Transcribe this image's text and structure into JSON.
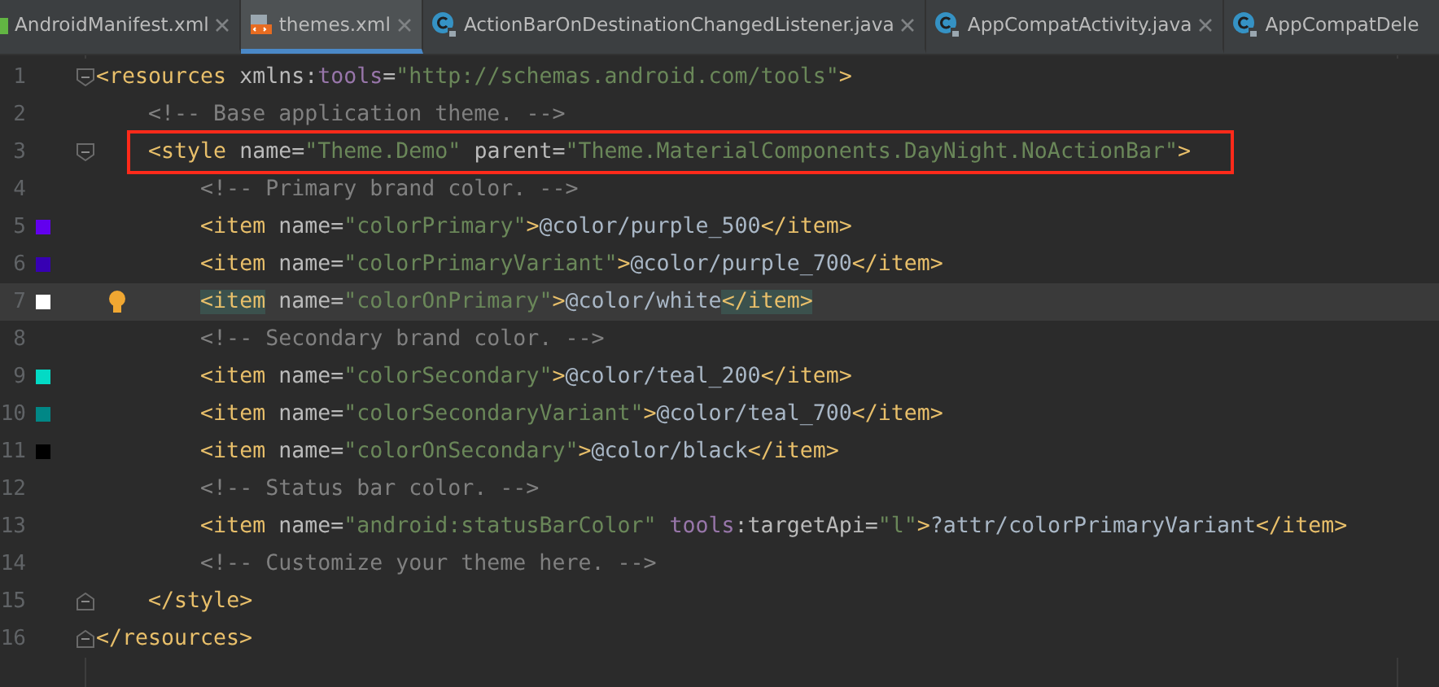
{
  "tabs": [
    {
      "label": "AndroidManifest.xml",
      "kind": "manifest",
      "selected": false,
      "closable": true
    },
    {
      "label": "themes.xml",
      "kind": "xml",
      "selected": true,
      "closable": true
    },
    {
      "label": "ActionBarOnDestinationChangedListener.java",
      "kind": "class",
      "selected": false,
      "closable": true
    },
    {
      "label": "AppCompatActivity.java",
      "kind": "class",
      "selected": false,
      "closable": true
    },
    {
      "label": "AppCompatDele",
      "kind": "class",
      "selected": false,
      "closable": false
    }
  ],
  "editor": {
    "lines": [
      {
        "number": "1",
        "fold_open": true,
        "tokens": [
          {
            "kind": "tag",
            "text": "<resources "
          },
          {
            "kind": "attr",
            "text": "xmlns:"
          },
          {
            "kind": "ns",
            "text": "tools"
          },
          {
            "kind": "attr",
            "text": "="
          },
          {
            "kind": "value",
            "text": "\"http://schemas.android.com/tools\""
          },
          {
            "kind": "tag",
            "text": ">"
          }
        ]
      },
      {
        "number": "2",
        "tokens": [
          {
            "kind": "comment",
            "text": "    <!-- Base application theme. -->"
          }
        ]
      },
      {
        "number": "3",
        "fold_open": true,
        "annotated": true,
        "tokens": [
          {
            "kind": "tag",
            "text": "    <style "
          },
          {
            "kind": "attr",
            "text": "name="
          },
          {
            "kind": "value",
            "text": "\"Theme.Demo\" "
          },
          {
            "kind": "attr",
            "text": "parent="
          },
          {
            "kind": "value",
            "text": "\"Theme.MaterialComponents.DayNight.NoActionBar\""
          },
          {
            "kind": "tag",
            "text": ">"
          }
        ]
      },
      {
        "number": "4",
        "tokens": [
          {
            "kind": "comment",
            "text": "        <!-- Primary brand color. -->"
          }
        ]
      },
      {
        "number": "5",
        "color": "#6200ee",
        "tokens": [
          {
            "kind": "tag",
            "text": "        <item "
          },
          {
            "kind": "attr",
            "text": "name="
          },
          {
            "kind": "value",
            "text": "\"colorPrimary\""
          },
          {
            "kind": "tag",
            "text": ">"
          },
          {
            "kind": "text",
            "text": "@color/purple_500"
          },
          {
            "kind": "tag",
            "text": "</item>"
          }
        ]
      },
      {
        "number": "6",
        "color": "#3700b3",
        "tokens": [
          {
            "kind": "tag",
            "text": "        <item "
          },
          {
            "kind": "attr",
            "text": "name="
          },
          {
            "kind": "value",
            "text": "\"colorPrimaryVariant\""
          },
          {
            "kind": "tag",
            "text": ">"
          },
          {
            "kind": "text",
            "text": "@color/purple_700"
          },
          {
            "kind": "tag",
            "text": "</item>"
          }
        ]
      },
      {
        "number": "7",
        "color": "#ffffff",
        "current": true,
        "bulb": true,
        "tokens": [
          {
            "kind": "tag",
            "text": "        <item",
            "matched": true
          },
          {
            "kind": "attr",
            "text": " name="
          },
          {
            "kind": "value",
            "text": "\"colorOnPrimary\""
          },
          {
            "kind": "tag",
            "text": ">"
          },
          {
            "kind": "text",
            "text": "@color/white"
          },
          {
            "kind": "tag",
            "text": "</item>",
            "matched": true
          }
        ]
      },
      {
        "number": "8",
        "tokens": [
          {
            "kind": "comment",
            "text": "        <!-- Secondary brand color. -->"
          }
        ]
      },
      {
        "number": "9",
        "color": "#03dac5",
        "tokens": [
          {
            "kind": "tag",
            "text": "        <item "
          },
          {
            "kind": "attr",
            "text": "name="
          },
          {
            "kind": "value",
            "text": "\"colorSecondary\""
          },
          {
            "kind": "tag",
            "text": ">"
          },
          {
            "kind": "text",
            "text": "@color/teal_200"
          },
          {
            "kind": "tag",
            "text": "</item>"
          }
        ]
      },
      {
        "number": "10",
        "color": "#018786",
        "tokens": [
          {
            "kind": "tag",
            "text": "        <item "
          },
          {
            "kind": "attr",
            "text": "name="
          },
          {
            "kind": "value",
            "text": "\"colorSecondaryVariant\""
          },
          {
            "kind": "tag",
            "text": ">"
          },
          {
            "kind": "text",
            "text": "@color/teal_700"
          },
          {
            "kind": "tag",
            "text": "</item>"
          }
        ]
      },
      {
        "number": "11",
        "color": "#000000",
        "tokens": [
          {
            "kind": "tag",
            "text": "        <item "
          },
          {
            "kind": "attr",
            "text": "name="
          },
          {
            "kind": "value",
            "text": "\"colorOnSecondary\""
          },
          {
            "kind": "tag",
            "text": ">"
          },
          {
            "kind": "text",
            "text": "@color/black"
          },
          {
            "kind": "tag",
            "text": "</item>"
          }
        ]
      },
      {
        "number": "12",
        "tokens": [
          {
            "kind": "comment",
            "text": "        <!-- Status bar color. -->"
          }
        ]
      },
      {
        "number": "13",
        "tokens": [
          {
            "kind": "tag",
            "text": "        <item "
          },
          {
            "kind": "attr",
            "text": "name="
          },
          {
            "kind": "value",
            "text": "\"android:statusBarColor\" "
          },
          {
            "kind": "ns",
            "text": "tools"
          },
          {
            "kind": "attr",
            "text": ":targetApi="
          },
          {
            "kind": "value",
            "text": "\"l\""
          },
          {
            "kind": "tag",
            "text": ">"
          },
          {
            "kind": "text",
            "text": "?attr/colorPrimaryVariant"
          },
          {
            "kind": "tag",
            "text": "</item>"
          }
        ]
      },
      {
        "number": "14",
        "tokens": [
          {
            "kind": "comment",
            "text": "        <!-- Customize your theme here. -->"
          }
        ]
      },
      {
        "number": "15",
        "fold_close": true,
        "tokens": [
          {
            "kind": "tag",
            "text": "    </style>"
          }
        ]
      },
      {
        "number": "16",
        "fold_close": true,
        "tokens": [
          {
            "kind": "tag",
            "text": "</resources>"
          }
        ]
      }
    ]
  }
}
